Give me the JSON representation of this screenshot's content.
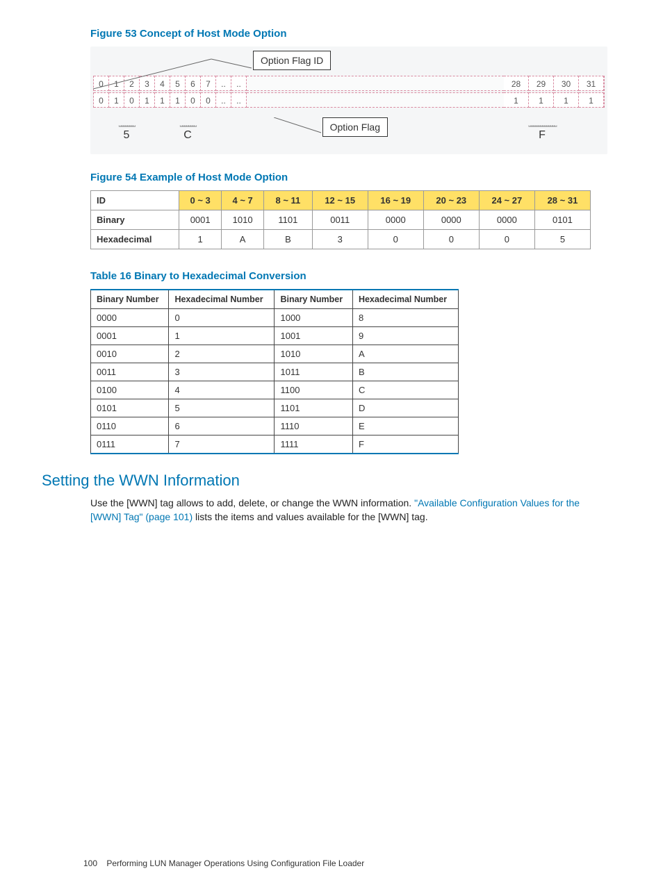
{
  "figure53": {
    "caption": "Figure 53 Concept of Host Mode Option",
    "optionFlagIdLabel": "Option Flag ID",
    "optionFlagLabel": "Option Flag",
    "idsLeft": [
      "0",
      "1",
      "2",
      "3",
      "4",
      "5",
      "6",
      "7",
      "..",
      "..",
      ""
    ],
    "idsRight": [
      "28",
      "29",
      "30",
      "31"
    ],
    "flagsLeft": [
      "0",
      "1",
      "0",
      "1",
      "1",
      "1",
      "0",
      "0",
      "..",
      "..",
      ""
    ],
    "flagsRight": [
      "1",
      "1",
      "1",
      "1"
    ],
    "hexLeft1": "5",
    "hexLeft2": "C",
    "hexRight": "F"
  },
  "figure54": {
    "caption": "Figure 54 Example of Host Mode Option",
    "headers": [
      "ID",
      "0 ~ 3",
      "4 ~ 7",
      "8 ~ 11",
      "12 ~ 15",
      "16 ~ 19",
      "20 ~ 23",
      "24 ~ 27",
      "28 ~ 31"
    ],
    "binaryRow": [
      "Binary",
      "0001",
      "1010",
      "1101",
      "0011",
      "0000",
      "0000",
      "0000",
      "0101"
    ],
    "hexRow": [
      "Hexadecimal",
      "1",
      "A",
      "B",
      "3",
      "0",
      "0",
      "0",
      "5"
    ]
  },
  "table16": {
    "caption": "Table 16 Binary to Hexadecimal Conversion",
    "headers": [
      "Binary Number",
      "Hexadecimal Number",
      "Binary Number",
      "Hexadecimal Number"
    ],
    "rows": [
      [
        "0000",
        "0",
        "1000",
        "8"
      ],
      [
        "0001",
        "1",
        "1001",
        "9"
      ],
      [
        "0010",
        "2",
        "1010",
        "A"
      ],
      [
        "0011",
        "3",
        "1011",
        "B"
      ],
      [
        "0100",
        "4",
        "1100",
        "C"
      ],
      [
        "0101",
        "5",
        "1101",
        "D"
      ],
      [
        "0110",
        "6",
        "1110",
        "E"
      ],
      [
        "0111",
        "7",
        "1111",
        "F"
      ]
    ]
  },
  "section": {
    "heading": "Setting the WWN Information",
    "para_pre": "Use the [WWN] tag allows to add, delete, or change the WWN information. ",
    "link": "\"Available Configuration Values for the [WWN] Tag\" (page 101)",
    "para_post": " lists the items and values available for the [WWN] tag."
  },
  "footer": {
    "page": "100",
    "text": "Performing LUN Manager Operations Using Configuration File Loader"
  }
}
